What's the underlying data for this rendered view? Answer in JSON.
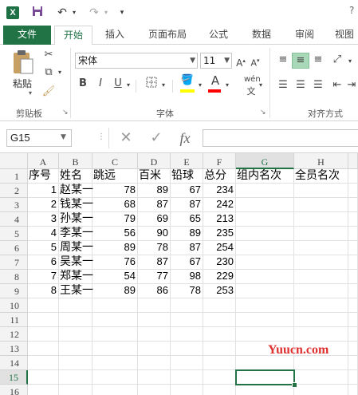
{
  "app": {
    "logo_text": "X"
  },
  "tabs": [
    {
      "label": "文件"
    },
    {
      "label": "开始"
    },
    {
      "label": "插入"
    },
    {
      "label": "页面布局"
    },
    {
      "label": "公式"
    },
    {
      "label": "数据"
    },
    {
      "label": "审阅"
    },
    {
      "label": "视图"
    }
  ],
  "ribbon": {
    "clipboard": {
      "paste_label": "粘贴",
      "group_label": "剪贴板"
    },
    "font": {
      "name": "宋体",
      "size": "11",
      "group_label": "字体",
      "bold": "B",
      "italic": "I",
      "underline": "U",
      "wen": "wén",
      "fill_color": "#ffff00",
      "font_color": "#ff0000"
    },
    "alignment": {
      "group_label": "对齐方式"
    }
  },
  "formula_bar": {
    "name_box": "G15",
    "cancel": "✕",
    "confirm": "✓",
    "fx": "fx",
    "formula": ""
  },
  "columns": [
    "A",
    "B",
    "C",
    "D",
    "E",
    "F",
    "G",
    "H"
  ],
  "rows": [
    [
      "序号",
      "姓名",
      "跳远",
      "百米",
      "铅球",
      "总分",
      "组内名次",
      "全员名次"
    ],
    [
      "1",
      "赵某一",
      "78",
      "89",
      "67",
      "234",
      "",
      ""
    ],
    [
      "2",
      "钱某一",
      "68",
      "87",
      "87",
      "242",
      "",
      ""
    ],
    [
      "3",
      "孙某一",
      "79",
      "69",
      "65",
      "213",
      "",
      ""
    ],
    [
      "4",
      "李某一",
      "56",
      "90",
      "89",
      "235",
      "",
      ""
    ],
    [
      "5",
      "周某一",
      "89",
      "78",
      "87",
      "254",
      "",
      ""
    ],
    [
      "6",
      "吴某一",
      "76",
      "87",
      "67",
      "230",
      "",
      ""
    ],
    [
      "7",
      "郑某一",
      "54",
      "77",
      "98",
      "229",
      "",
      ""
    ],
    [
      "8",
      "王某一",
      "89",
      "86",
      "78",
      "253",
      "",
      ""
    ],
    [
      "",
      "",
      "",
      "",
      "",
      "",
      "",
      ""
    ],
    [
      "",
      "",
      "",
      "",
      "",
      "",
      "",
      ""
    ],
    [
      "",
      "",
      "",
      "",
      "",
      "",
      "",
      ""
    ],
    [
      "",
      "",
      "",
      "",
      "",
      "",
      "",
      ""
    ],
    [
      "",
      "",
      "",
      "",
      "",
      "",
      "",
      ""
    ],
    [
      "",
      "",
      "",
      "",
      "",
      "",
      "",
      ""
    ],
    [
      "",
      "",
      "",
      "",
      "",
      "",
      "",
      ""
    ]
  ],
  "row_numbers": [
    "1",
    "2",
    "3",
    "4",
    "5",
    "6",
    "7",
    "8",
    "9",
    "10",
    "11",
    "12",
    "13",
    "14",
    "15",
    "16"
  ],
  "selected_cell": "G15",
  "watermark": "Yuucn.com",
  "accent": "#217346"
}
